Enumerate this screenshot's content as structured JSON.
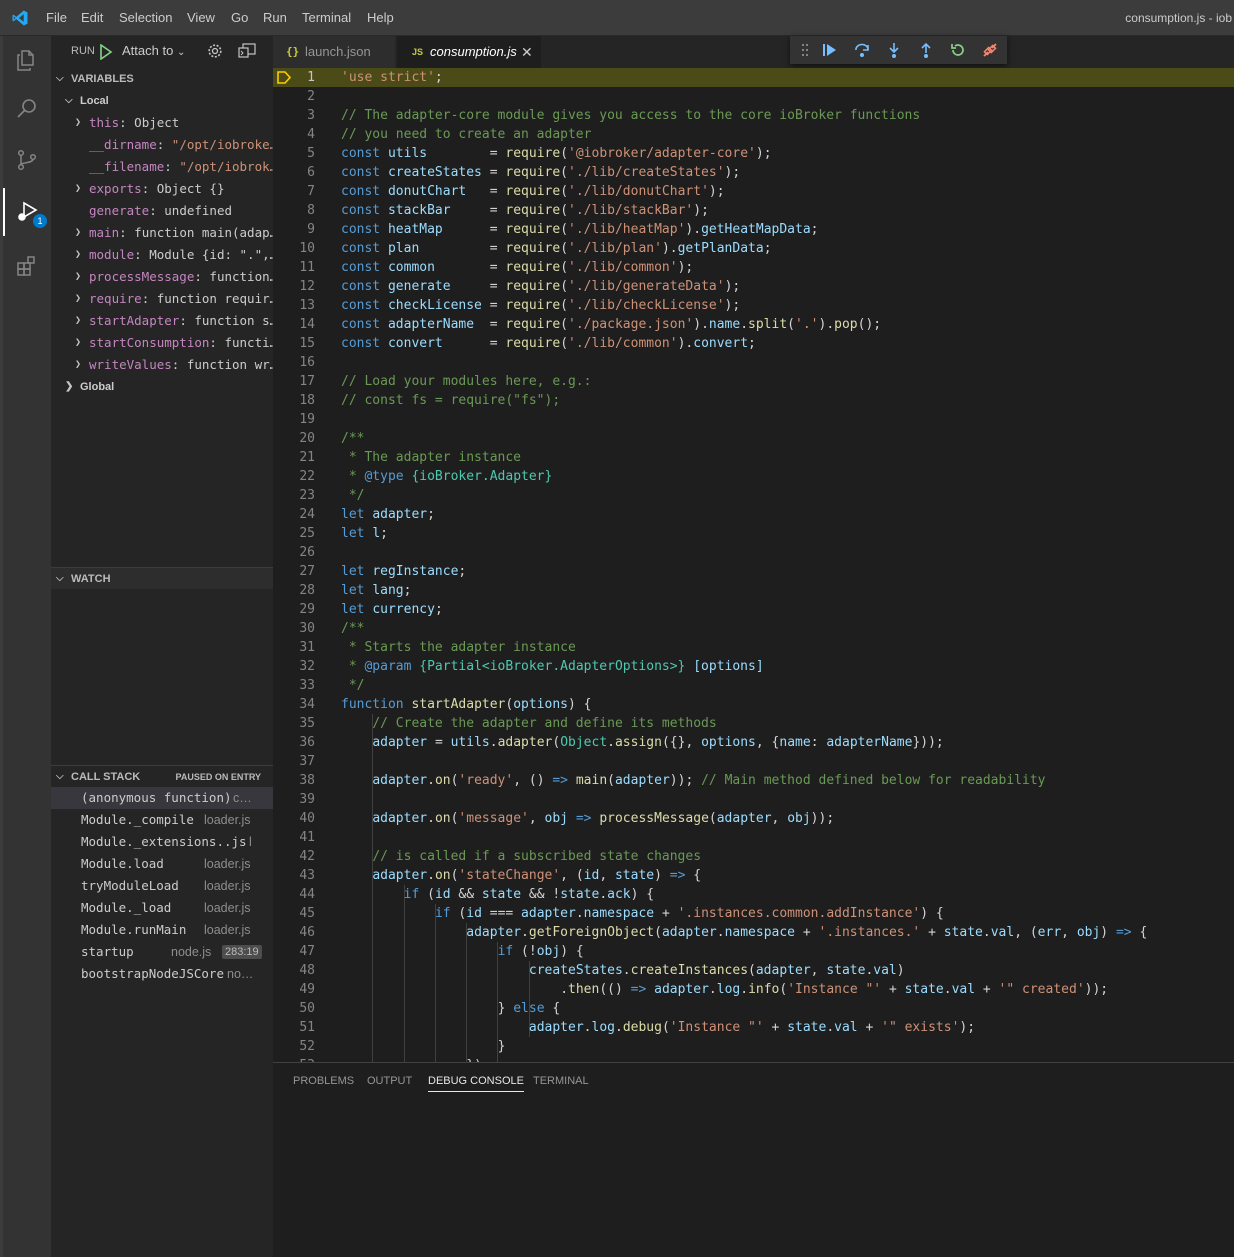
{
  "titlebar": {
    "menu": [
      "File",
      "Edit",
      "Selection",
      "View",
      "Go",
      "Run",
      "Terminal",
      "Help"
    ],
    "window_title": "consumption.js - iob"
  },
  "activity": {
    "debug_badge": "1"
  },
  "run": {
    "label": "RUN",
    "config": "Attach to"
  },
  "variables": {
    "header": "VARIABLES",
    "local_label": "Local",
    "global_label": "Global",
    "items": [
      {
        "name": "this",
        "value": "Object"
      },
      {
        "name": "__dirname",
        "value": "\"/opt/iobroke…"
      },
      {
        "name": "__filename",
        "value": "\"/opt/iobrok…"
      },
      {
        "name": "exports",
        "value": "Object {}"
      },
      {
        "name": "generate",
        "value": "undefined"
      },
      {
        "name": "main",
        "value": "function main(adap…"
      },
      {
        "name": "module",
        "value": "Module {id: \".\",…"
      },
      {
        "name": "processMessage",
        "value": "function…"
      },
      {
        "name": "require",
        "value": "function requir…"
      },
      {
        "name": "startAdapter",
        "value": "function s…"
      },
      {
        "name": "startConsumption",
        "value": "functi…"
      },
      {
        "name": "writeValues",
        "value": "function wr…"
      }
    ]
  },
  "watch": {
    "header": "WATCH"
  },
  "callstack": {
    "header": "CALL STACK",
    "status": "PAUSED ON ENTRY",
    "frames": [
      {
        "fn": "(anonymous function)",
        "file": "c…"
      },
      {
        "fn": "Module._compile",
        "file": "loader.js"
      },
      {
        "fn": "Module._extensions..js",
        "file": "l"
      },
      {
        "fn": "Module.load",
        "file": "loader.js"
      },
      {
        "fn": "tryModuleLoad",
        "file": "loader.js"
      },
      {
        "fn": "Module._load",
        "file": "loader.js"
      },
      {
        "fn": "Module.runMain",
        "file": "loader.js"
      },
      {
        "fn": "startup",
        "file": "node.js",
        "pos": "283:19"
      },
      {
        "fn": "bootstrapNodeJSCore",
        "file": "no…"
      }
    ]
  },
  "tabs": [
    {
      "icon": "{}",
      "label": "launch.json",
      "active": false
    },
    {
      "icon": "JS",
      "label": "consumption.js",
      "active": true
    }
  ],
  "panel": {
    "tabs": [
      "PROBLEMS",
      "OUTPUT",
      "DEBUG CONSOLE",
      "TERMINAL"
    ],
    "active": "DEBUG CONSOLE"
  },
  "code": [
    "'use strict';",
    "",
    "// The adapter-core module gives you access to the core ioBroker functions",
    "// you need to create an adapter",
    "const utils        = require('@iobroker/adapter-core');",
    "const createStates = require('./lib/createStates');",
    "const donutChart   = require('./lib/donutChart');",
    "const stackBar     = require('./lib/stackBar');",
    "const heatMap      = require('./lib/heatMap').getHeatMapData;",
    "const plan         = require('./lib/plan').getPlanData;",
    "const common       = require('./lib/common');",
    "const generate     = require('./lib/generateData');",
    "const checkLicense = require('./lib/checkLicense');",
    "const adapterName  = require('./package.json').name.split('.').pop();",
    "const convert      = require('./lib/common').convert;",
    "",
    "// Load your modules here, e.g.:",
    "// const fs = require(\"fs\");",
    "",
    "/**",
    " * The adapter instance",
    " * @type {ioBroker.Adapter}",
    " */",
    "let adapter;",
    "let l;",
    "",
    "let regInstance;",
    "let lang;",
    "let currency;",
    "/**",
    " * Starts the adapter instance",
    " * @param {Partial<ioBroker.AdapterOptions>} [options]",
    " */",
    "function startAdapter(options) {",
    "    // Create the adapter and define its methods",
    "    adapter = utils.adapter(Object.assign({}, options, {name: adapterName}));",
    "",
    "    adapter.on('ready', () => main(adapter)); // Main method defined below for readability",
    "",
    "    adapter.on('message', obj => processMessage(adapter, obj));",
    "",
    "    // is called if a subscribed state changes",
    "    adapter.on('stateChange', (id, state) => {",
    "        if (id && state && !state.ack) {",
    "            if (id === adapter.namespace + '.instances.common.addInstance') {",
    "                adapter.getForeignObject(adapter.namespace + '.instances.' + state.val, (err, obj) => {",
    "                    if (!obj) {",
    "                        createStates.createInstances(adapter, state.val)",
    "                            .then(() => adapter.log.info('Instance \"' + state.val + '\" created'));",
    "                    } else {",
    "                        adapter.log.debug('Instance \"' + state.val + '\" exists');",
    "                    }",
    "                })"
  ],
  "colors": {
    "keyword": "#569cd6",
    "string": "#ce9178",
    "comment": "#6a9955",
    "function": "#dcdcaa",
    "variable": "#9cdcfe",
    "type": "#4ec9b0",
    "accent": "#007acc",
    "paused_line": "#4b4b18"
  }
}
